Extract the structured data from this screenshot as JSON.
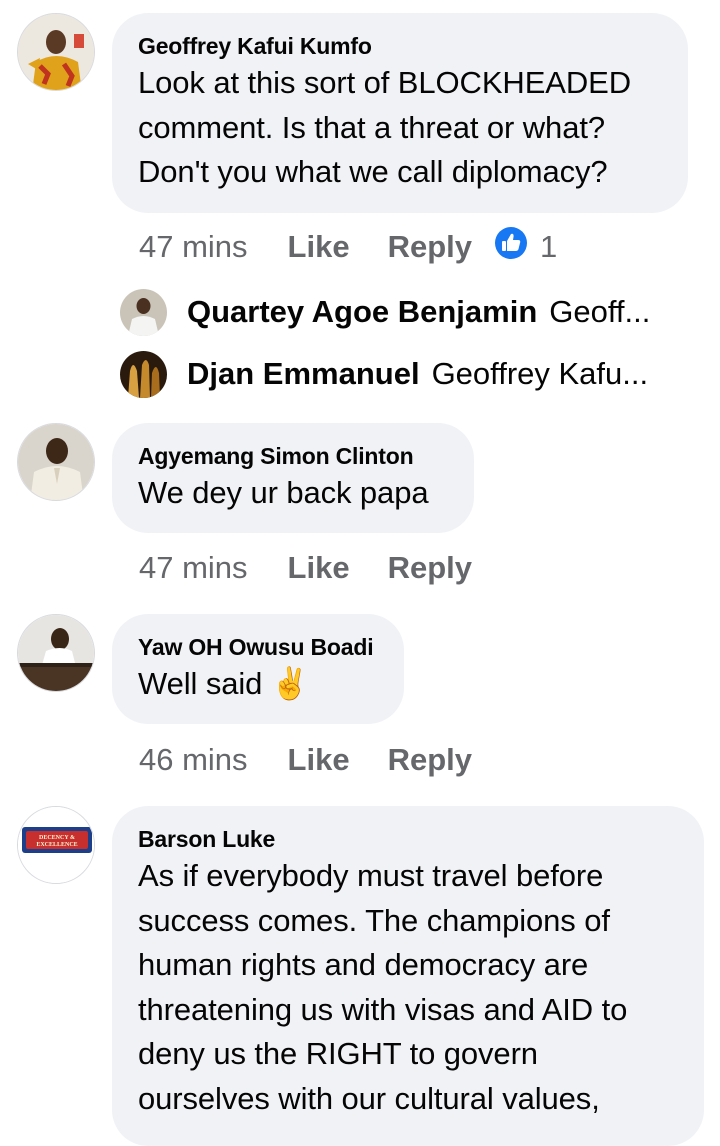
{
  "colors": {
    "bubble_bg": "#f0f2f5",
    "meta_text": "#65676b",
    "like_blue": "#1877f2"
  },
  "comments": [
    {
      "author": "Geoffrey Kafui Kumfo",
      "text": "Look at this sort of BLOCKHEADED\ncomment. Is that a threat or what?\nDon't you what we call diplomacy?",
      "time": "47 mins",
      "like": "Like",
      "reply": "Reply",
      "reaction_icon": "thumbs-up-icon",
      "reaction_count": "1",
      "replies": [
        {
          "name": "Quartey Agoe Benjamin",
          "preview": "Geoff..."
        },
        {
          "name": "Djan Emmanuel",
          "preview": "Geoffrey Kafu..."
        }
      ]
    },
    {
      "author": "Agyemang Simon Clinton",
      "text": "We dey ur back papa",
      "time": "47 mins",
      "like": "Like",
      "reply": "Reply"
    },
    {
      "author": "Yaw OH Owusu Boadi",
      "text": "Well said ✌️",
      "time": "46 mins",
      "like": "Like",
      "reply": "Reply"
    },
    {
      "author": "Barson Luke",
      "text": "As if everybody must travel before\nsuccess comes. The champions of\nhuman rights and democracy are\nthreatening us with visas and AID to\ndeny us the RIGHT to govern\nourselves with  our cultural values,",
      "avatar_logo_lines": [
        "DECENCY &",
        "EXCELLENCE"
      ]
    }
  ]
}
